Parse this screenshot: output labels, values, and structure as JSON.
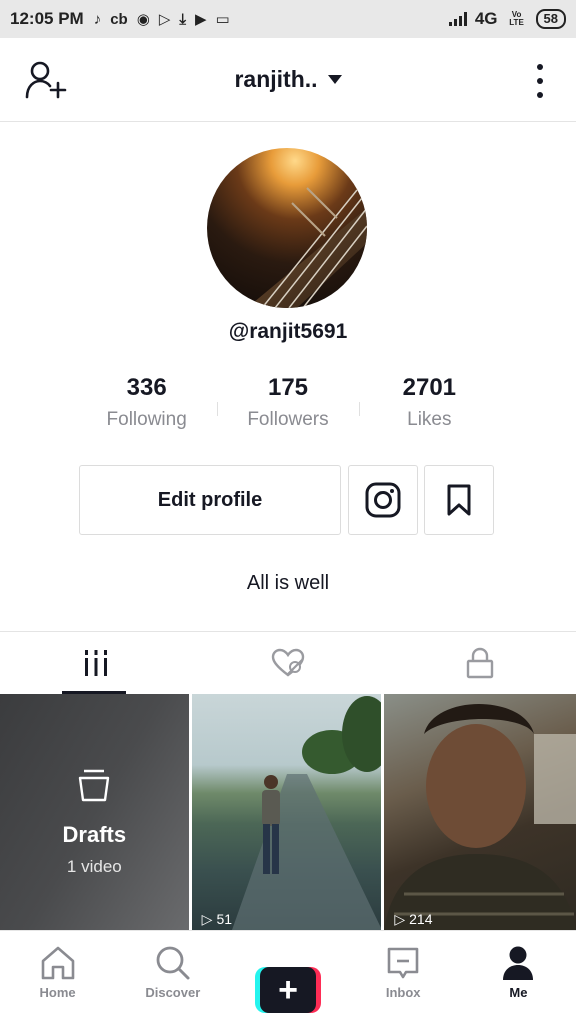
{
  "status_bar": {
    "time": "12:05 PM",
    "app_icons": [
      "tiktok-icon",
      "cb-icon",
      "camera-icon",
      "play-store-icon",
      "download-icon",
      "youtube-icon",
      "storage-icon"
    ],
    "network": "4G",
    "volte": "Vo LTE",
    "battery": "58"
  },
  "header": {
    "username": "ranjith..",
    "add_user_icon": "add-user-icon",
    "more_icon": "more-vertical-icon"
  },
  "profile": {
    "handle": "@ranjit5691",
    "stats": [
      {
        "value": "336",
        "label": "Following"
      },
      {
        "value": "175",
        "label": "Followers"
      },
      {
        "value": "2701",
        "label": "Likes"
      }
    ],
    "edit_profile_label": "Edit profile",
    "bio": "All is well"
  },
  "tabs": [
    {
      "icon": "grid-icon",
      "active": true
    },
    {
      "icon": "liked-hidden-icon",
      "active": false
    },
    {
      "icon": "lock-icon",
      "active": false
    }
  ],
  "videos": {
    "drafts": {
      "title": "Drafts",
      "subtitle": "1 video"
    },
    "items": [
      {
        "views": "51"
      },
      {
        "views": "214"
      }
    ]
  },
  "bottom_nav": [
    {
      "label": "Home",
      "icon": "home-icon"
    },
    {
      "label": "Discover",
      "icon": "search-icon"
    },
    {
      "label": "",
      "icon": "plus-icon"
    },
    {
      "label": "Inbox",
      "icon": "inbox-icon"
    },
    {
      "label": "Me",
      "icon": "person-icon"
    }
  ]
}
